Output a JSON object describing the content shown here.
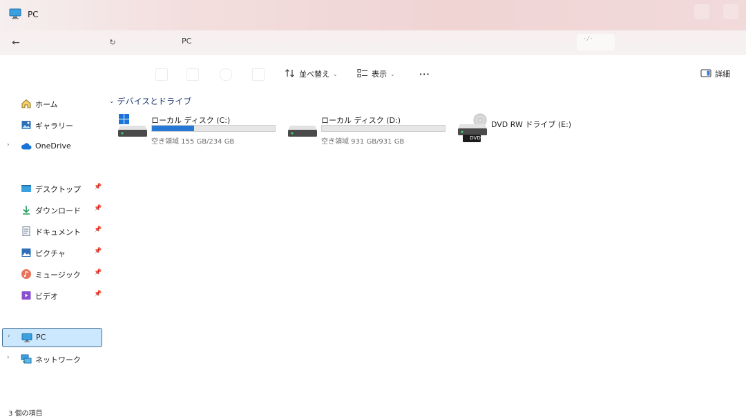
{
  "window": {
    "title": "PC"
  },
  "address": {
    "path": "PC",
    "search_hint": "· ⁄ ·"
  },
  "toolbar": {
    "sort_label": "並べ替え",
    "view_label": "表示",
    "more_label": "···",
    "details_label": "詳細"
  },
  "sidebar": {
    "items": [
      {
        "label": "ホーム",
        "icon": "home-icon"
      },
      {
        "label": "ギャラリー",
        "icon": "gallery-icon"
      },
      {
        "label": "OneDrive",
        "icon": "cloud-icon"
      },
      {
        "label": "デスクトップ",
        "icon": "desktop-icon"
      },
      {
        "label": "ダウンロード",
        "icon": "download-icon"
      },
      {
        "label": "ドキュメント",
        "icon": "document-icon"
      },
      {
        "label": "ピクチャ",
        "icon": "pictures-icon"
      },
      {
        "label": "ミュージック",
        "icon": "music-icon"
      },
      {
        "label": "ビデオ",
        "icon": "video-icon"
      },
      {
        "label": "PC",
        "icon": "pc-icon",
        "selected": true
      },
      {
        "label": "ネットワーク",
        "icon": "network-icon"
      }
    ]
  },
  "main": {
    "group_title": "デバイスとドライブ",
    "drives": [
      {
        "name": "ローカル ディスク (C:)",
        "free": "空き領域 155 GB/234 GB",
        "used_percent": 34
      },
      {
        "name": "ローカル ディスク (D:)",
        "free": "空き領域 931 GB/931 GB",
        "used_percent": 0
      },
      {
        "name": "DVD RW ドライブ (E:)",
        "badge": "DVD"
      }
    ]
  },
  "status": {
    "item_count": "3 個の項目"
  },
  "colors": {
    "accent": "#2779d6",
    "selection": "#cce8ff",
    "group_header": "#1f3b73"
  }
}
